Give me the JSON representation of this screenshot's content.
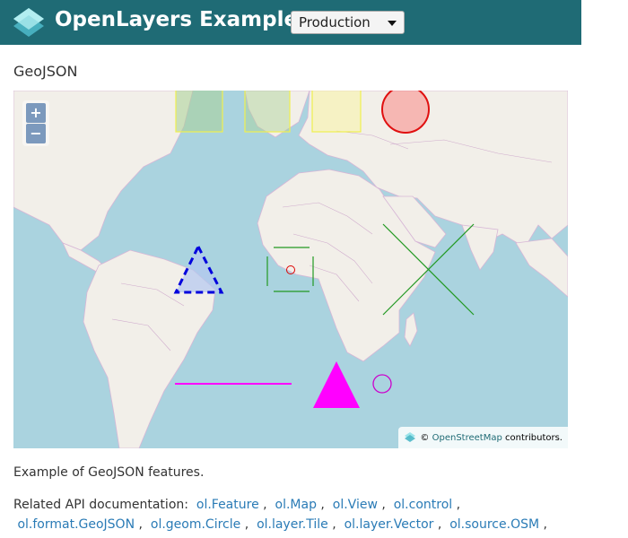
{
  "header": {
    "brand": "OpenLayers Examples",
    "mode_select": {
      "selected": "Production"
    }
  },
  "page": {
    "title": "GeoJSON",
    "description": "Example of GeoJSON features.",
    "api_label": "Related API documentation:",
    "api_links_line1": [
      "ol.Feature",
      "ol.Map",
      "ol.View",
      "ol.control"
    ],
    "api_links_line2": [
      "ol.format.GeoJSON",
      "ol.geom.Circle",
      "ol.layer.Tile",
      "ol.layer.Vector",
      "ol.source.OSM"
    ]
  },
  "map": {
    "zoom_in": "+",
    "zoom_out": "−",
    "attribution": {
      "prefix": "©",
      "link": "OpenStreetMap",
      "suffix": "contributors."
    }
  },
  "colors": {
    "header_bg": "#1f6b75",
    "water": "#aad3df",
    "land": "#f2efe9",
    "link": "#2a7bb6"
  }
}
